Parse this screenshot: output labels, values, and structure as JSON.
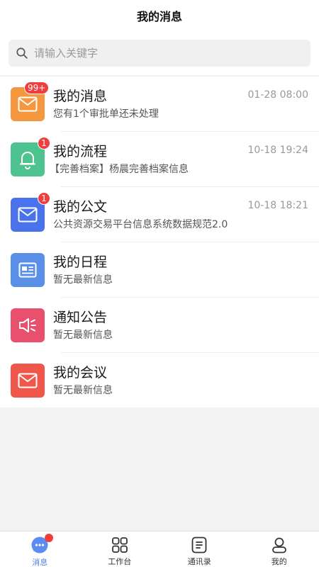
{
  "header": {
    "title": "我的消息"
  },
  "search": {
    "placeholder": "请输入关键字"
  },
  "items": [
    {
      "title": "我的消息",
      "subtitle": "您有1个审批单还未处理",
      "time": "01-28 08:00",
      "badge": "99+",
      "icon": "mail-icon",
      "color": "#f4973e"
    },
    {
      "title": "我的流程",
      "subtitle": "【完善档案】杨晨完善档案信息",
      "time": "10-18 19:24",
      "badge": "1",
      "icon": "bell-icon",
      "color": "#4fc38f"
    },
    {
      "title": "我的公文",
      "subtitle": "公共资源交易平台信息系统数据规范2.0",
      "time": "10-18 18:21",
      "badge": "1",
      "icon": "mail-icon",
      "color": "#4a72ea"
    },
    {
      "title": "我的日程",
      "subtitle": "暂无最新信息",
      "icon": "newspaper-icon",
      "color": "#5a8fe8"
    },
    {
      "title": "通知公告",
      "subtitle": "暂无最新信息",
      "icon": "speaker-icon",
      "color": "#e9506e"
    },
    {
      "title": "我的会议",
      "subtitle": "暂无最新信息",
      "icon": "mail-icon",
      "color": "#f0574b"
    }
  ],
  "tabbar": [
    {
      "label": "消息",
      "icon": "chat-icon",
      "active": true
    },
    {
      "label": "工作台",
      "icon": "grid-icon"
    },
    {
      "label": "通讯录",
      "icon": "contacts-icon"
    },
    {
      "label": "我的",
      "icon": "user-icon"
    }
  ]
}
